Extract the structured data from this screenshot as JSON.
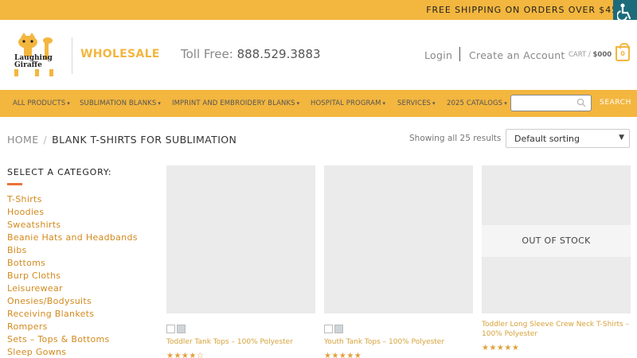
{
  "topbar": {
    "shipping_text": "FREE SHIPPING ON ORDERS OVER $45"
  },
  "accessibility": {
    "icon": "accessibility-icon"
  },
  "header": {
    "logo_text": "Laughing Giraffe",
    "wholesale": "WHOLESALE",
    "toll_free_label": "Toll Free:",
    "toll_free_number": "888.529.3883",
    "login": "Login",
    "create_account": "Create an Account",
    "cart_label": "CART /",
    "cart_amount": "$000",
    "cart_count": "0"
  },
  "nav": {
    "items": [
      {
        "label": "ALL PRODUCTS"
      },
      {
        "label": "SUBLIMATION BLANKS"
      },
      {
        "label": "IMPRINT AND EMBROIDERY BLANKS"
      },
      {
        "label": "HOSPITAL PROGRAM"
      },
      {
        "label": "SERVICES"
      },
      {
        "label": "2025 CATALOGS"
      }
    ],
    "search_placeholder": "",
    "search_button": "SEARCH"
  },
  "breadcrumb": {
    "home": "HOME",
    "separator": "/",
    "current": "BLANK T-SHIRTS FOR SUBLIMATION"
  },
  "results": {
    "showing": "Showing all 25 results"
  },
  "sort": {
    "selected": "Default sorting"
  },
  "sidebar": {
    "title": "SELECT A CATEGORY:",
    "categories": [
      "T-Shirts",
      "Hoodies",
      "Sweatshirts",
      "Beanie Hats and Headbands",
      "Bibs",
      "Bottoms",
      "Burp Cloths",
      "Leisurewear",
      "Onesies/Bodysuits",
      "Receiving Blankets",
      "Rompers",
      "Sets – Tops & Bottoms",
      "Sleep Gowns"
    ]
  },
  "products": [
    {
      "name": "Toddler Tank Tops – 100% Polyester",
      "rating": 4,
      "out_of_stock": ""
    },
    {
      "name": "Youth Tank Tops – 100% Polyester",
      "rating": 5,
      "out_of_stock": ""
    },
    {
      "name": "Toddler Long Sleeve Crew Neck T-Shirts – 100% Polyester",
      "rating": 5,
      "out_of_stock": "OUT OF STOCK"
    }
  ],
  "colors": {
    "accent": "#f3b63f",
    "link": "#d28a1e",
    "underline": "#e8743b",
    "a11y": "#1b6b7a"
  }
}
